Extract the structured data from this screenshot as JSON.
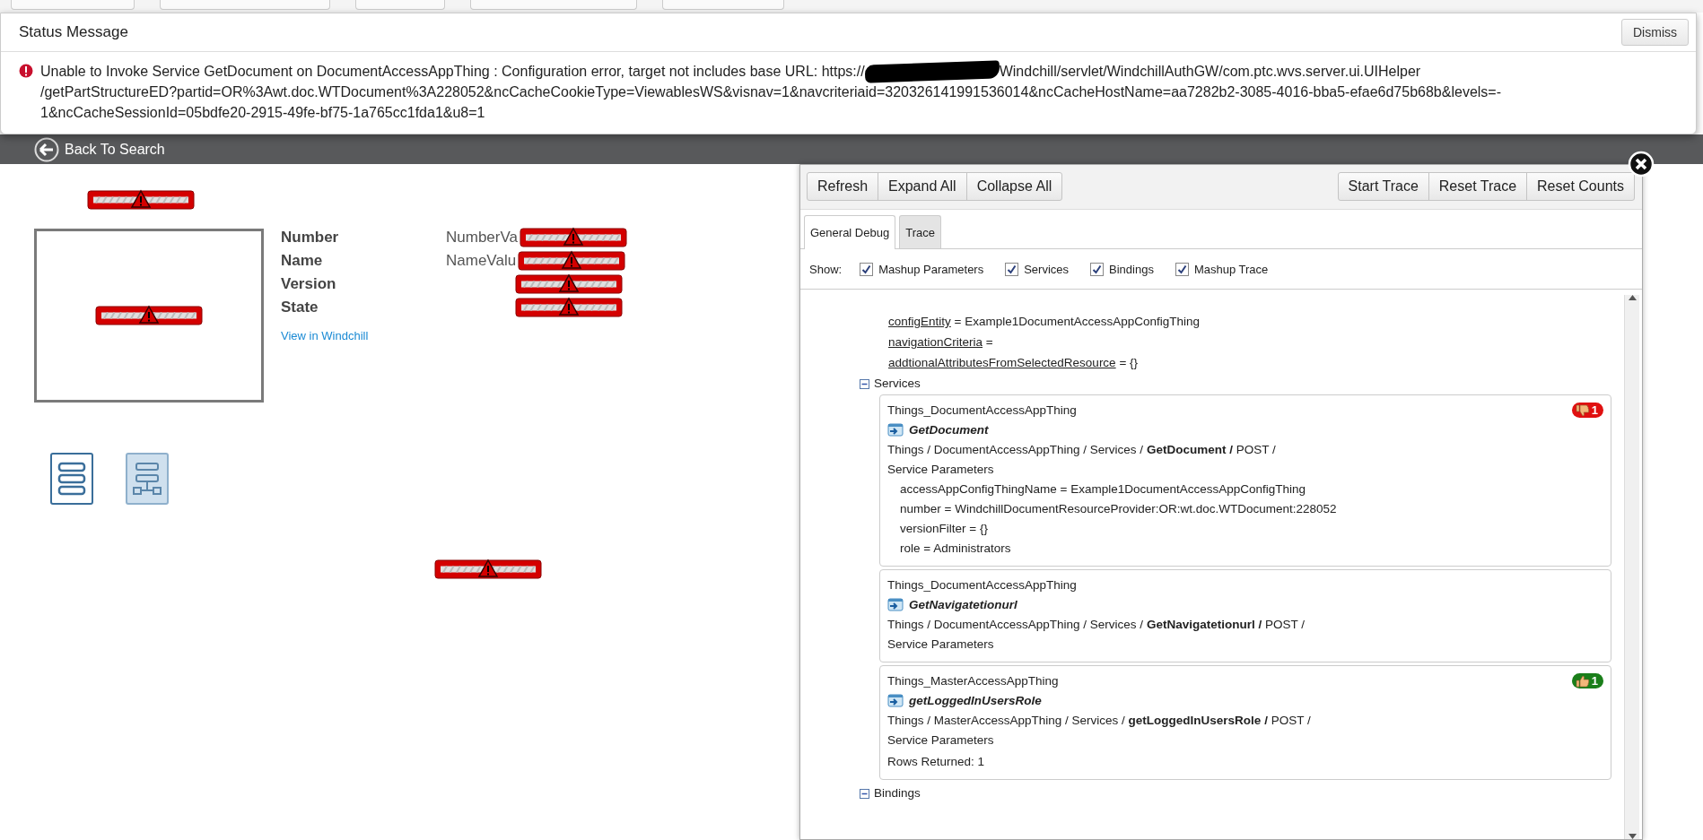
{
  "status_message": {
    "title": "Status Message",
    "dismiss": "Dismiss",
    "message": {
      "start": "Unable to Invoke Service GetDocument on DocumentAccessAppThing : Configuration error, target not includes base URL: https://",
      "redacted": true,
      "rest": [
        "Windchill/servlet/WindchillAuthGW/com.ptc.wvs.server.ui.UIHelper",
        "/getPartStructureED?partid=OR%3Awt.doc.WTDocument%3A228052&ncCacheCookieType=ViewablesWS&visnav=1&navcriteriaid=320326141991536014&ncCacheHostName=aa7282b2-3085-4016-bba5-efae6d75b68b&levels=-",
        "1&ncCacheSessionId=05bdfe20-2915-49fe-bf75-1a765cc1fda1&u8=1"
      ]
    }
  },
  "header": {
    "back_label": "Back To Search"
  },
  "details": {
    "fields": [
      {
        "label": "Number",
        "value": "NumberVa",
        "error": true
      },
      {
        "label": "Name",
        "value": "NameValu",
        "error": true
      },
      {
        "label": "Version",
        "error": true
      },
      {
        "label": "State",
        "error": true
      }
    ],
    "link": "View in Windchill"
  },
  "view_buttons": [
    {
      "kind": "list",
      "selected": false
    },
    {
      "kind": "tree",
      "selected": true
    }
  ],
  "debug": {
    "toolbar_left": [
      "Refresh",
      "Expand All",
      "Collapse All"
    ],
    "toolbar_right": [
      "Start Trace",
      "Reset Trace",
      "Reset Counts"
    ],
    "tabs": [
      {
        "label": "General Debug",
        "selected": true
      },
      {
        "label": "Trace",
        "selected": false
      }
    ],
    "show_label": "Show:",
    "filters": [
      {
        "label": "Mashup Parameters",
        "checked": true
      },
      {
        "label": "Services",
        "checked": true
      },
      {
        "label": "Bindings",
        "checked": true
      },
      {
        "label": "Mashup Trace",
        "checked": true
      }
    ],
    "parameters": [
      {
        "name": "configEntity",
        "value": "= Example1DocumentAccessAppConfigThing"
      },
      {
        "name": "navigationCriteria",
        "value": "="
      },
      {
        "name": "addtionalAttributesFromSelectedResource",
        "value": "= {}"
      }
    ],
    "sections": [
      {
        "title": "Services",
        "expanded": true,
        "items": [
          {
            "thing": "Things_DocumentAccessAppThing",
            "service": "GetDocument",
            "path": "Things / DocumentAccessAppThing / Services / **GetDocument /** POST /",
            "params_label": "Service Parameters",
            "params": [
              "accessAppConfigThingName = Example1DocumentAccessAppConfigThing",
              "number = WindchillDocumentResourceProvider:OR:wt.doc.WTDocument:228052",
              "versionFilter = {}",
              "role = Administrators"
            ],
            "badge": {
              "kind": "thumbs_down",
              "count": "1"
            }
          },
          {
            "thing": "Things_DocumentAccessAppThing",
            "service": "GetNavigatetionurl",
            "path": "Things / DocumentAccessAppThing / Services / **GetNavigatetionurl /** POST /",
            "params_label": "Service Parameters"
          },
          {
            "thing": "Things_MasterAccessAppThing",
            "service": "getLoggedInUsersRole",
            "path": "Things / MasterAccessAppThing / Services / **getLoggedInUsersRole /** POST /",
            "params_label": "Service Parameters",
            "rows": "Rows Returned: 1",
            "badge": {
              "kind": "thumbs_up",
              "count": "1"
            }
          }
        ]
      },
      {
        "title": "Bindings",
        "expanded": true
      }
    ]
  }
}
